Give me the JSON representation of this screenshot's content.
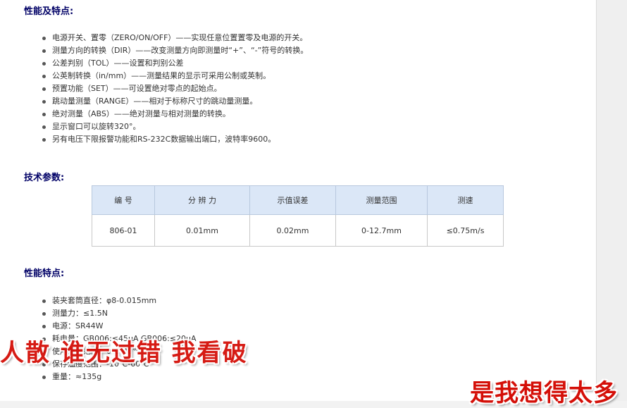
{
  "section1": {
    "title": "性能及特点:",
    "items": [
      "电源开关、置零（ZERO/ON/OFF）——实现任意位置置零及电源的开关。",
      "测量方向的转换（DIR）——改变测量方向即测量时“+”、“-”符号的转换。",
      "公差判别（TOL）——设置和判别公差",
      "公英制转换（in/mm）——测量结果的显示可采用公制或英制。",
      "预置功能（SET）——可设置绝对零点的起始点。",
      "跳动量测量（RANGE）——相对于标称尺寸的跳动量测量。",
      "绝对测量（ABS）——绝对测量与相对测量的转换。",
      "显示窗口可以旋转320°。",
      "另有电压下限报警功能和RS-232C数据输出端口，波特率9600。"
    ]
  },
  "section2": {
    "title": "技术参数:",
    "table": {
      "headers": [
        "编 号",
        "分 辨 力",
        "示值误差",
        "测量范围",
        "测速"
      ],
      "rows": [
        [
          "806-01",
          "0.01mm",
          "0.02mm",
          "0-12.7mm",
          "≤0.75m/s"
        ]
      ]
    }
  },
  "section3": {
    "title": "性能特点:",
    "items": [
      "装夹套筒直径：φ8-0.015mm",
      "测量力：≤1.5N",
      "电源：SR44W",
      "耗电量：GB006:≤45μA  GB006:≤20μA",
      "使用温度范围：0℃-40℃",
      "保存温度范围：-10℃-60℃",
      "重量：≈135g"
    ]
  },
  "overlays": {
    "text1": "人散 谁无过错 我看破",
    "text2": "是我想得太多"
  },
  "colors": {
    "heading": "#000066",
    "table_header_bg": "#dbe7f7",
    "overlay_red": "#d40f08"
  }
}
